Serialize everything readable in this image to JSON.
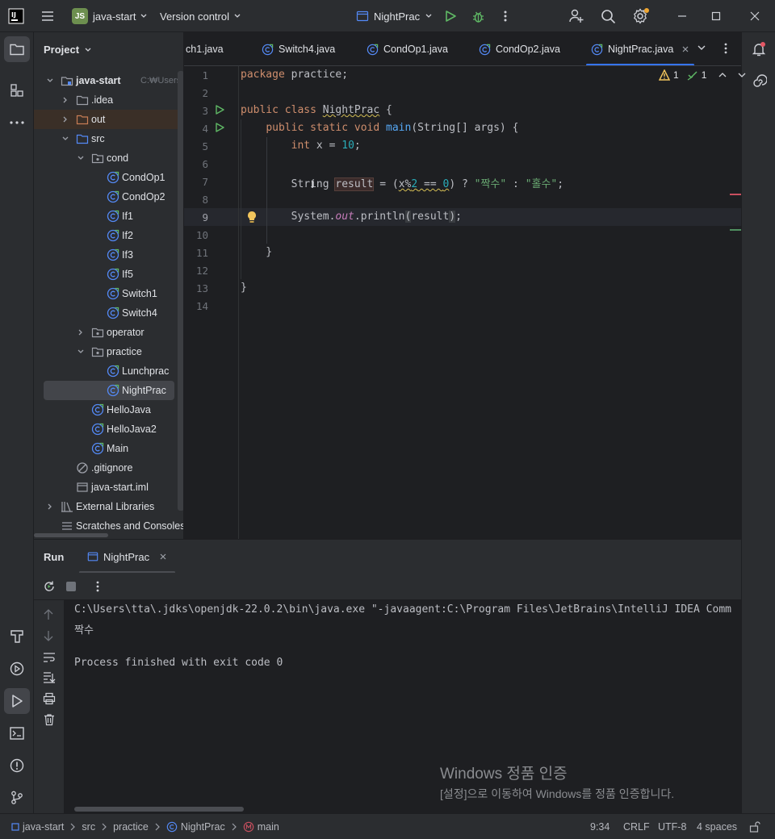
{
  "titlebar": {
    "project_badge": "JS",
    "project_name": "java-start",
    "vcs_label": "Version control",
    "run_config": "NightPrac"
  },
  "project_panel": {
    "title": "Project",
    "tree": [
      {
        "label": "java-start",
        "hint": "C:₩Users₩tta",
        "depth": 0,
        "type": "module",
        "expanded": true
      },
      {
        "label": ".idea",
        "depth": 1,
        "type": "folder",
        "expanded": false
      },
      {
        "label": "out",
        "depth": 1,
        "type": "folder-out",
        "expanded": false
      },
      {
        "label": "src",
        "depth": 1,
        "type": "folder-src",
        "expanded": true
      },
      {
        "label": "cond",
        "depth": 2,
        "type": "package",
        "expanded": true
      },
      {
        "label": "CondOp1",
        "depth": 3,
        "type": "class"
      },
      {
        "label": "CondOp2",
        "depth": 3,
        "type": "class"
      },
      {
        "label": "If1",
        "depth": 3,
        "type": "class"
      },
      {
        "label": "If2",
        "depth": 3,
        "type": "class"
      },
      {
        "label": "If3",
        "depth": 3,
        "type": "class"
      },
      {
        "label": "If5",
        "depth": 3,
        "type": "class"
      },
      {
        "label": "Switch1",
        "depth": 3,
        "type": "class"
      },
      {
        "label": "Switch4",
        "depth": 3,
        "type": "class"
      },
      {
        "label": "operator",
        "depth": 2,
        "type": "package",
        "expanded": false
      },
      {
        "label": "practice",
        "depth": 2,
        "type": "package",
        "expanded": true
      },
      {
        "label": "Lunchprac",
        "depth": 3,
        "type": "class"
      },
      {
        "label": "NightPrac",
        "depth": 3,
        "type": "class",
        "selected": true
      },
      {
        "label": "HelloJava",
        "depth": 2,
        "type": "class"
      },
      {
        "label": "HelloJava2",
        "depth": 2,
        "type": "class"
      },
      {
        "label": "Main",
        "depth": 2,
        "type": "class"
      },
      {
        "label": ".gitignore",
        "depth": 1,
        "type": "ignore"
      },
      {
        "label": "java-start.iml",
        "depth": 1,
        "type": "iml"
      },
      {
        "label": "External Libraries",
        "depth": 0,
        "type": "library",
        "expanded": false
      },
      {
        "label": "Scratches and Consoles",
        "depth": 0,
        "type": "scratch"
      }
    ]
  },
  "tabs": [
    {
      "label": "ch1.java"
    },
    {
      "label": "Switch4.java"
    },
    {
      "label": "CondOp1.java"
    },
    {
      "label": "CondOp2.java"
    },
    {
      "label": "NightPrac.java",
      "active": true
    }
  ],
  "inspections": {
    "warnings": "1",
    "weak_warnings": "1"
  },
  "line_numbers": [
    "1",
    "2",
    "3",
    "4",
    "5",
    "6",
    "7",
    "8",
    "9",
    "10",
    "11",
    "12",
    "13",
    "14"
  ],
  "run_panel": {
    "title": "Run",
    "tab_label": "NightPrac",
    "console_lines": [
      "C:\\Users\\tta\\.jdks\\openjdk-22.0.2\\bin\\java.exe \"-javaagent:C:\\Program Files\\JetBrains\\IntelliJ IDEA Comm",
      "짝수",
      "",
      "Process finished with exit code 0"
    ]
  },
  "watermark": {
    "title": "Windows 정품 인증",
    "subtitle": "[설정]으로 이동하여 Windows를 정품 인증합니다."
  },
  "statusbar": {
    "breadcrumbs": [
      "java-start",
      "src",
      "practice",
      "NightPrac",
      "main"
    ],
    "position": "9:34",
    "line_sep": "CRLF",
    "encoding": "UTF-8",
    "indent": "4 spaces"
  },
  "colors": {
    "accent": "#3574f0",
    "keyword": "#cf8e6d",
    "function": "#56a8f5",
    "number": "#2aacb8",
    "string": "#6aab73",
    "run_green": "#5fb865"
  }
}
